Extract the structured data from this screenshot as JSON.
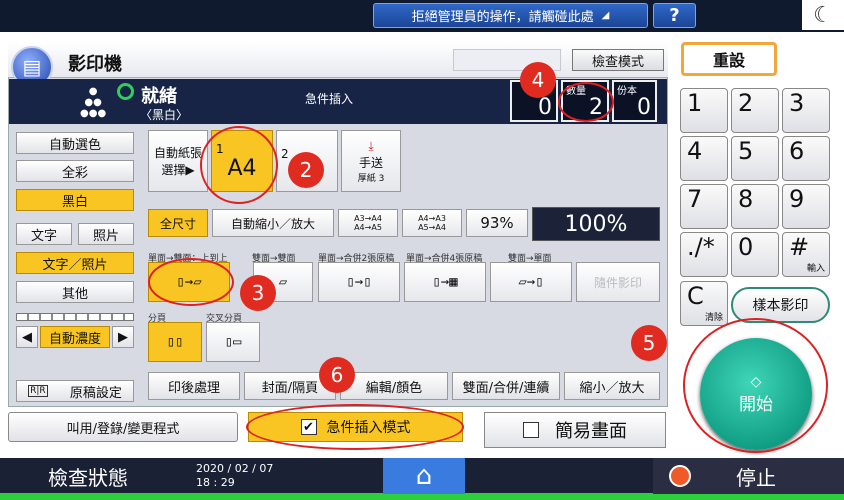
{
  "top_bar": {
    "admin_message": "拒絕管理員的操作，請觸碰此處",
    "help_label": "?",
    "moon_icon": "☾"
  },
  "header": {
    "title": "影印機",
    "blank_button": "",
    "check_mode": "檢查模式"
  },
  "status": {
    "state": "就緒",
    "color_mode": "〈黑白〉",
    "interrupt_label": "急件插入",
    "counters": [
      {
        "label": "",
        "value": "0"
      },
      {
        "label": "數量",
        "value": "2"
      },
      {
        "label": "份本",
        "value": "0"
      }
    ]
  },
  "left_panel": {
    "items": [
      "自動選色",
      "全彩",
      "黑白",
      "文字",
      "照片",
      "文字／照片",
      "其他",
      "自動濃度",
      "原稿設定"
    ],
    "density_left": "◀",
    "density_right": "▶",
    "orig_icon": "R|R"
  },
  "paper": {
    "auto_select": "自動紙張選擇▶",
    "tray1_label": "1",
    "tray1_size": "A4",
    "tray2_label": "2",
    "bypass_label": "手送",
    "bypass_sub": "厚紙 3",
    "bypass_icon": "⤓",
    "lock_icon": "🔒"
  },
  "zoom": {
    "full_size": "全尺寸",
    "auto_reduce": "自動縮小／放大",
    "a3_a4": "A3→A4\nA4→A5",
    "a4_a3": "A4→A3\nA5→A4",
    "preset_pct": "93%",
    "ratio": "100%"
  },
  "duplex": {
    "captions": [
      "單面→雙面：上到上",
      "雙面→雙面",
      "單面→合併2張原稿",
      "單面→合併4張原稿",
      "雙面→單面"
    ],
    "disabled_label": "隨件影印",
    "sort_caption": "分頁",
    "rotate_caption": "交叉分頁"
  },
  "bottom_tabs": [
    "印後處理",
    "封面/隔頁",
    "編輯/顏色",
    "雙面/合併/連續",
    "縮小／放大"
  ],
  "actions": {
    "recall": "叫用/登錄/變更程式",
    "interrupt_mode": "急件插入模式",
    "interrupt_check": "✔",
    "simple_screen": "簡易畫面"
  },
  "keypad": {
    "reset": "重設",
    "keys": [
      "1",
      "2",
      "3",
      "4",
      "5",
      "6",
      "7",
      "8",
      "9",
      "./*",
      "0",
      "#"
    ],
    "hash_sub": "輸入",
    "clear": "C",
    "clear_sub": "清除",
    "sample": "樣本影印",
    "start": "開始",
    "start_icon": "◇"
  },
  "bottom_bar": {
    "check_status": "檢查狀態",
    "date": "2020 / 02 / 07",
    "time": "18 : 29",
    "home_icon": "⌂",
    "stop": "停止"
  },
  "annotations": [
    "2",
    "3",
    "4",
    "5",
    "6"
  ],
  "colors": {
    "accent_yellow": "#f8c523",
    "start_green": "#129f85",
    "annotation_red": "#e02020",
    "status_navy": "#172446"
  }
}
